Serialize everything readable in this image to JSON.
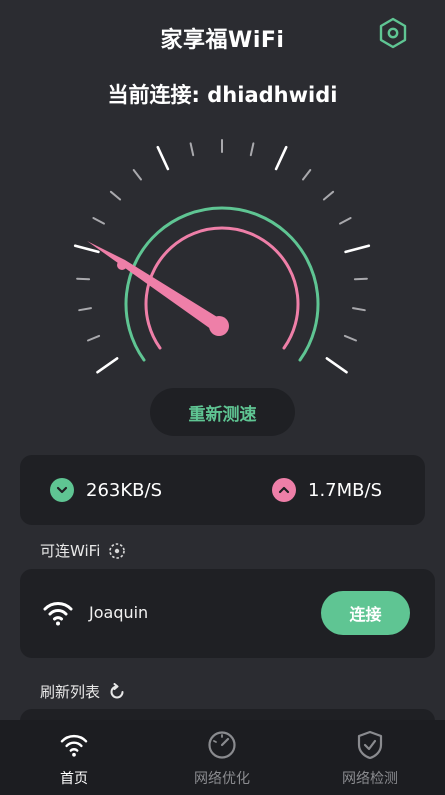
{
  "header": {
    "title": "家享福WiFi",
    "settings_icon": "hexagon-gear-icon"
  },
  "connection": {
    "prefix": "当前连接:",
    "ssid": "dhiadhwidi"
  },
  "gauge": {
    "outer_ring_color": "#5fc593",
    "inner_ring_color": "#ee7fa8",
    "needle_color": "#ee7fa8"
  },
  "retest_button": "重新测速",
  "speeds": {
    "download": {
      "icon": "chevron-down-circle-icon",
      "value": "263KB/S",
      "color": "#5fc593"
    },
    "upload": {
      "icon": "chevron-up-circle-icon",
      "value": "1.7MB/S",
      "color": "#ee7fa8"
    }
  },
  "available_wifi": {
    "label": "可连WiFi",
    "icon": "scanning-icon",
    "networks": [
      {
        "name": "Joaquin",
        "icon": "wifi-icon",
        "button": "连接"
      }
    ]
  },
  "refresh": {
    "label": "刷新列表",
    "icon": "refresh-icon"
  },
  "nav": [
    {
      "label": "首页",
      "icon": "wifi-icon",
      "active": true
    },
    {
      "label": "网络优化",
      "icon": "speedometer-icon",
      "active": false
    },
    {
      "label": "网络检测",
      "icon": "shield-check-icon",
      "active": false
    }
  ],
  "colors": {
    "background": "#2b2c31",
    "card": "#1f2024",
    "accent_green": "#5fc593",
    "accent_pink": "#ee7fa8"
  }
}
